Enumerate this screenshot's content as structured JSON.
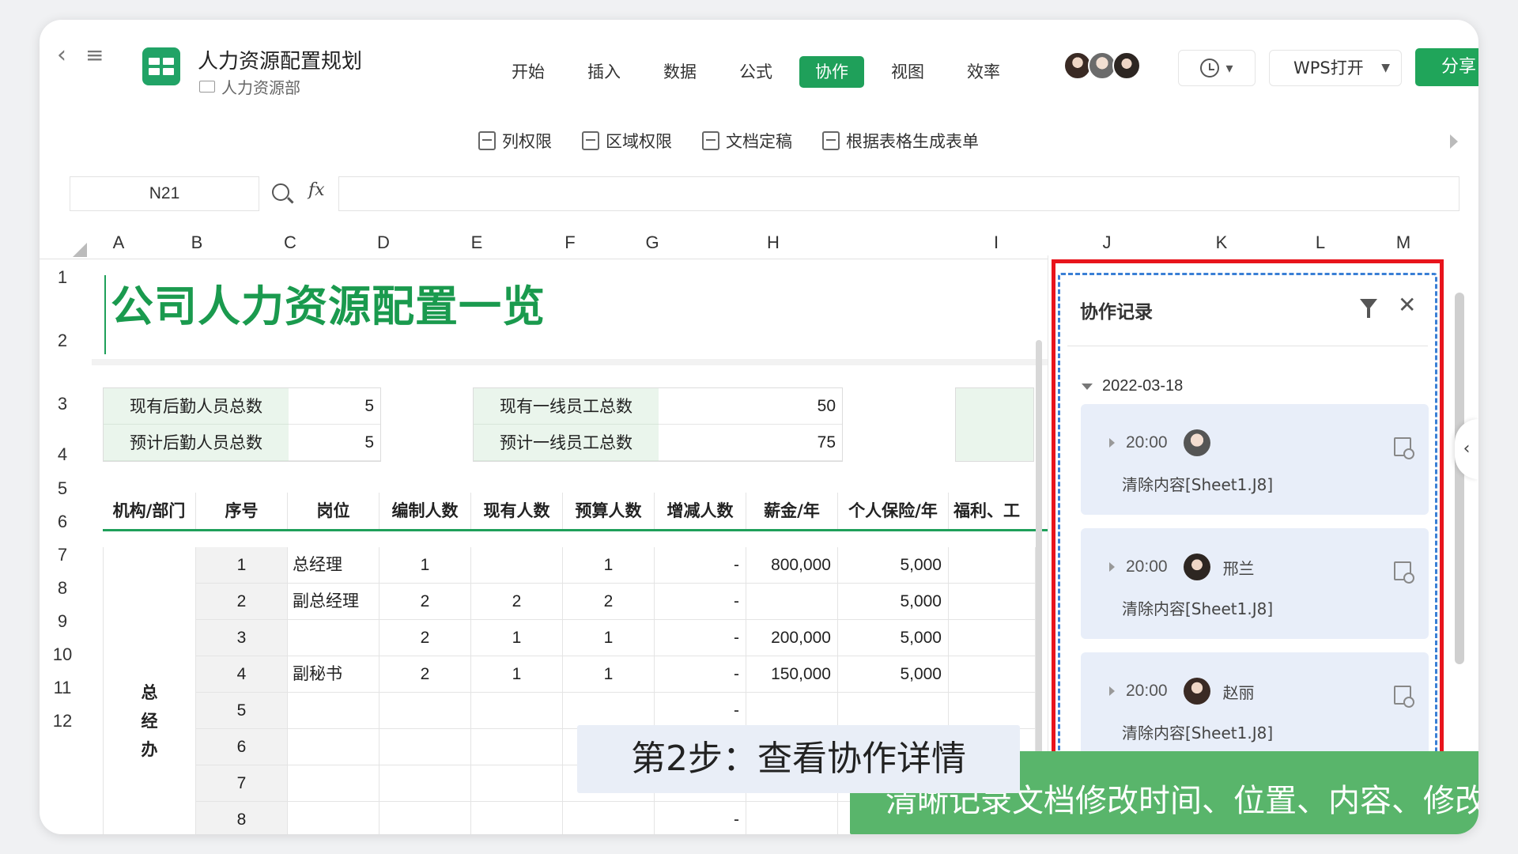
{
  "app": {
    "doc_title": "人力资源配置规划",
    "folder": "人力资源部"
  },
  "tabs": [
    {
      "label": "开始",
      "active": false
    },
    {
      "label": "插入",
      "active": false
    },
    {
      "label": "数据",
      "active": false
    },
    {
      "label": "公式",
      "active": false
    },
    {
      "label": "协作",
      "active": true
    },
    {
      "label": "视图",
      "active": false
    },
    {
      "label": "效率",
      "active": false
    }
  ],
  "header": {
    "open_label": "WPS打开",
    "share_label": "分享"
  },
  "subtoolbar": [
    {
      "label": "列权限",
      "icon": "column-permission-icon"
    },
    {
      "label": "区域权限",
      "icon": "area-permission-icon"
    },
    {
      "label": "文档定稿",
      "icon": "finalize-icon"
    },
    {
      "label": "根据表格生成表单",
      "icon": "form-icon"
    }
  ],
  "formula_bar": {
    "cell_ref": "N21",
    "fx": "fx",
    "formula": ""
  },
  "columns": [
    "A",
    "B",
    "C",
    "D",
    "E",
    "F",
    "G",
    "H",
    "I",
    "J",
    "K",
    "L",
    "M"
  ],
  "rows": [
    "1",
    "2",
    "3",
    "4",
    "5",
    "6",
    "7",
    "8",
    "9",
    "10",
    "11",
    "12"
  ],
  "sheet": {
    "title": "公司人力资源配置一览",
    "summary": [
      {
        "label": "现有后勤人员总数",
        "value": "5"
      },
      {
        "label": "预计后勤人员总数",
        "value": "5"
      },
      {
        "label": "现有一线员工总数",
        "value": "50"
      },
      {
        "label": "预计一线员工总数",
        "value": "75"
      }
    ],
    "table_headers": [
      "机构/部门",
      "序号",
      "岗位",
      "编制人数",
      "现有人数",
      "预算人数",
      "增减人数",
      "薪金/年",
      "个人保险/年",
      "福利、工"
    ],
    "dept": "总经办",
    "dept_chars": [
      "总",
      "经",
      "办"
    ],
    "rows": [
      [
        "1",
        "总经理",
        "1",
        "",
        "1",
        "-",
        "800,000",
        "5,000"
      ],
      [
        "2",
        "副总经理",
        "2",
        "2",
        "2",
        "-",
        "",
        "5,000"
      ],
      [
        "3",
        "",
        "2",
        "1",
        "1",
        "-",
        "200,000",
        "5,000"
      ],
      [
        "4",
        "副秘书",
        "2",
        "1",
        "1",
        "-",
        "150,000",
        "5,000"
      ],
      [
        "5",
        "",
        "",
        "",
        "",
        "-",
        "",
        ""
      ],
      [
        "6",
        "",
        "",
        "",
        "",
        "",
        "",
        ""
      ],
      [
        "7",
        "",
        "",
        "",
        "",
        "",
        "",
        ""
      ],
      [
        "8",
        "",
        "",
        "",
        "",
        "-",
        "",
        ""
      ]
    ]
  },
  "collab_panel": {
    "title": "协作记录",
    "date": "2022-03-18",
    "records": [
      {
        "time": "20:00",
        "user": "",
        "desc": "清除内容[Sheet1.J8]"
      },
      {
        "time": "20:00",
        "user": "邢兰",
        "desc": "清除内容[Sheet1.J8]"
      },
      {
        "time": "20:00",
        "user": "赵丽",
        "desc": "清除内容[Sheet1.J8]"
      }
    ]
  },
  "overlay": {
    "step_caption": "第2步：查看协作详情",
    "banner": "清晰记录文档修改时间、位置、内容、修改人"
  },
  "colors": {
    "accent": "#1fa05a",
    "highlight_red": "#e8141c",
    "dashed_blue": "#3a7fd5"
  }
}
